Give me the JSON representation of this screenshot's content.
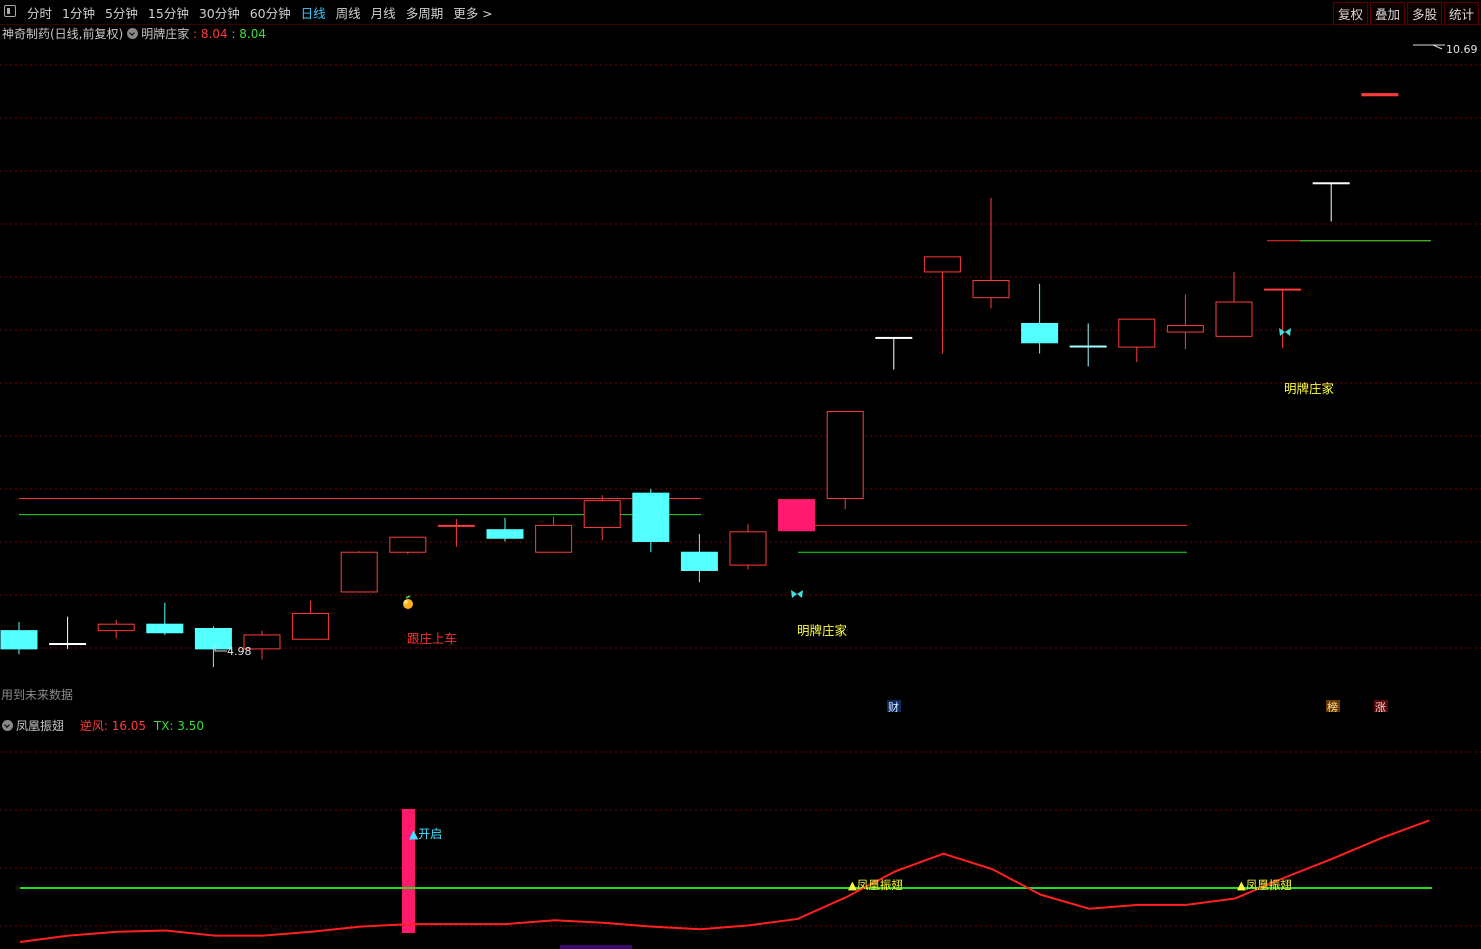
{
  "toolbar": {
    "periods": [
      "分时",
      "1分钟",
      "5分钟",
      "15分钟",
      "30分钟",
      "60分钟",
      "日线",
      "周线",
      "月线",
      "多周期",
      "更多 >"
    ],
    "active_period": "日线",
    "right_buttons": [
      "复权",
      "叠加",
      "多股",
      "统计"
    ]
  },
  "main": {
    "stock_title": "神奇制药(日线,前复权)",
    "indicator_name": "明牌庄家",
    "indicator_value1": ": 8.04",
    "indicator_value2": ": 8.04",
    "high_marker": "10.69",
    "low_marker": "4.98",
    "signal_label_follow": "跟庄上车",
    "signal_label_dealer1": "明牌庄家",
    "signal_label_dealer2": "明牌庄家",
    "future_data_note": "用到未来数据",
    "badge_cai": "财",
    "badge_bang": "榜",
    "badge_zhang": "涨"
  },
  "sub": {
    "indicator_name": "凤凰振翅",
    "nifeng_label": "逆风: 16.05",
    "tx_label": "TX: 3.50",
    "open_label": "▲开启",
    "phoenix_label1": "▲凤凰振翅",
    "phoenix_label2": "▲凤凰振翅"
  },
  "colors": {
    "up": "#ff3b3b",
    "down": "#54ffff",
    "signal_bar": "#ff1a6e",
    "grid": "#7a0000",
    "green_line": "#22dd22",
    "text_yellow": "#ffff40"
  },
  "chart_data": {
    "type": "candlestick",
    "candles": [
      {
        "o": 5.32,
        "h": 5.4,
        "l": 5.1,
        "c": 5.15
      },
      {
        "o": 5.2,
        "h": 5.45,
        "l": 5.15,
        "c": 5.2
      },
      {
        "o": 5.32,
        "h": 5.42,
        "l": 5.25,
        "c": 5.38
      },
      {
        "o": 5.38,
        "h": 5.58,
        "l": 5.28,
        "c": 5.3
      },
      {
        "o": 5.34,
        "h": 5.36,
        "l": 4.98,
        "c": 5.15
      },
      {
        "o": 5.15,
        "h": 5.32,
        "l": 5.05,
        "c": 5.28
      },
      {
        "o": 5.24,
        "h": 5.6,
        "l": 5.24,
        "c": 5.48
      },
      {
        "o": 5.68,
        "h": 6.06,
        "l": 5.68,
        "c": 6.05
      },
      {
        "o": 6.05,
        "h": 6.19,
        "l": 6.03,
        "c": 6.19
      },
      {
        "o": 6.3,
        "h": 6.36,
        "l": 6.1,
        "c": 6.3
      },
      {
        "o": 6.26,
        "h": 6.37,
        "l": 6.15,
        "c": 6.18
      },
      {
        "o": 6.05,
        "h": 6.38,
        "l": 6.05,
        "c": 6.3
      },
      {
        "o": 6.28,
        "h": 6.58,
        "l": 6.16,
        "c": 6.53
      },
      {
        "o": 6.6,
        "h": 6.64,
        "l": 6.05,
        "c": 6.15
      },
      {
        "o": 6.05,
        "h": 6.22,
        "l": 5.77,
        "c": 5.88
      },
      {
        "o": 5.93,
        "h": 6.31,
        "l": 5.89,
        "c": 6.24
      },
      {
        "o": 6.54,
        "h": 6.54,
        "l": 6.25,
        "c": 6.25
      },
      {
        "o": 6.55,
        "h": 7.36,
        "l": 6.45,
        "c": 7.36
      },
      {
        "o": 8.05,
        "h": 8.05,
        "l": 7.75,
        "c": 8.05
      },
      {
        "o": 8.66,
        "h": 8.66,
        "l": 7.9,
        "c": 8.8
      },
      {
        "o": 8.42,
        "h": 9.35,
        "l": 8.32,
        "c": 8.58
      },
      {
        "o": 8.18,
        "h": 8.55,
        "l": 7.9,
        "c": 8.0
      },
      {
        "o": 7.97,
        "h": 8.18,
        "l": 7.78,
        "c": 7.97
      },
      {
        "o": 7.96,
        "h": 8.22,
        "l": 7.82,
        "c": 8.22
      },
      {
        "o": 8.1,
        "h": 8.45,
        "l": 7.94,
        "c": 8.16
      },
      {
        "o": 8.06,
        "h": 8.66,
        "l": 8.06,
        "c": 8.38
      },
      {
        "o": 8.5,
        "h": 8.5,
        "l": 7.95,
        "c": 8.5
      },
      {
        "o": 9.49,
        "h": 9.49,
        "l": 9.13,
        "c": 9.49
      },
      {
        "o": 10.3,
        "h": 10.32,
        "l": 10.3,
        "c": 10.32
      }
    ],
    "red_level_1": 6.55,
    "green_level_1": 6.4,
    "red_level_2": 6.3,
    "green_level_2": 6.05,
    "red_level_3": 8.95,
    "green_level_3": 8.95,
    "sub_series": {
      "name": "逆风",
      "values": [
        1.5,
        2.0,
        2.3,
        2.4,
        2.0,
        2.0,
        2.3,
        2.7,
        2.9,
        2.9,
        2.9,
        3.2,
        3.0,
        2.7,
        2.5,
        2.8,
        3.3,
        5.0,
        7.0,
        8.4,
        7.2,
        5.2,
        4.1,
        4.4,
        4.4,
        4.9,
        6.5,
        8.0,
        9.6,
        11.0
      ],
      "tx": 3.5
    }
  }
}
